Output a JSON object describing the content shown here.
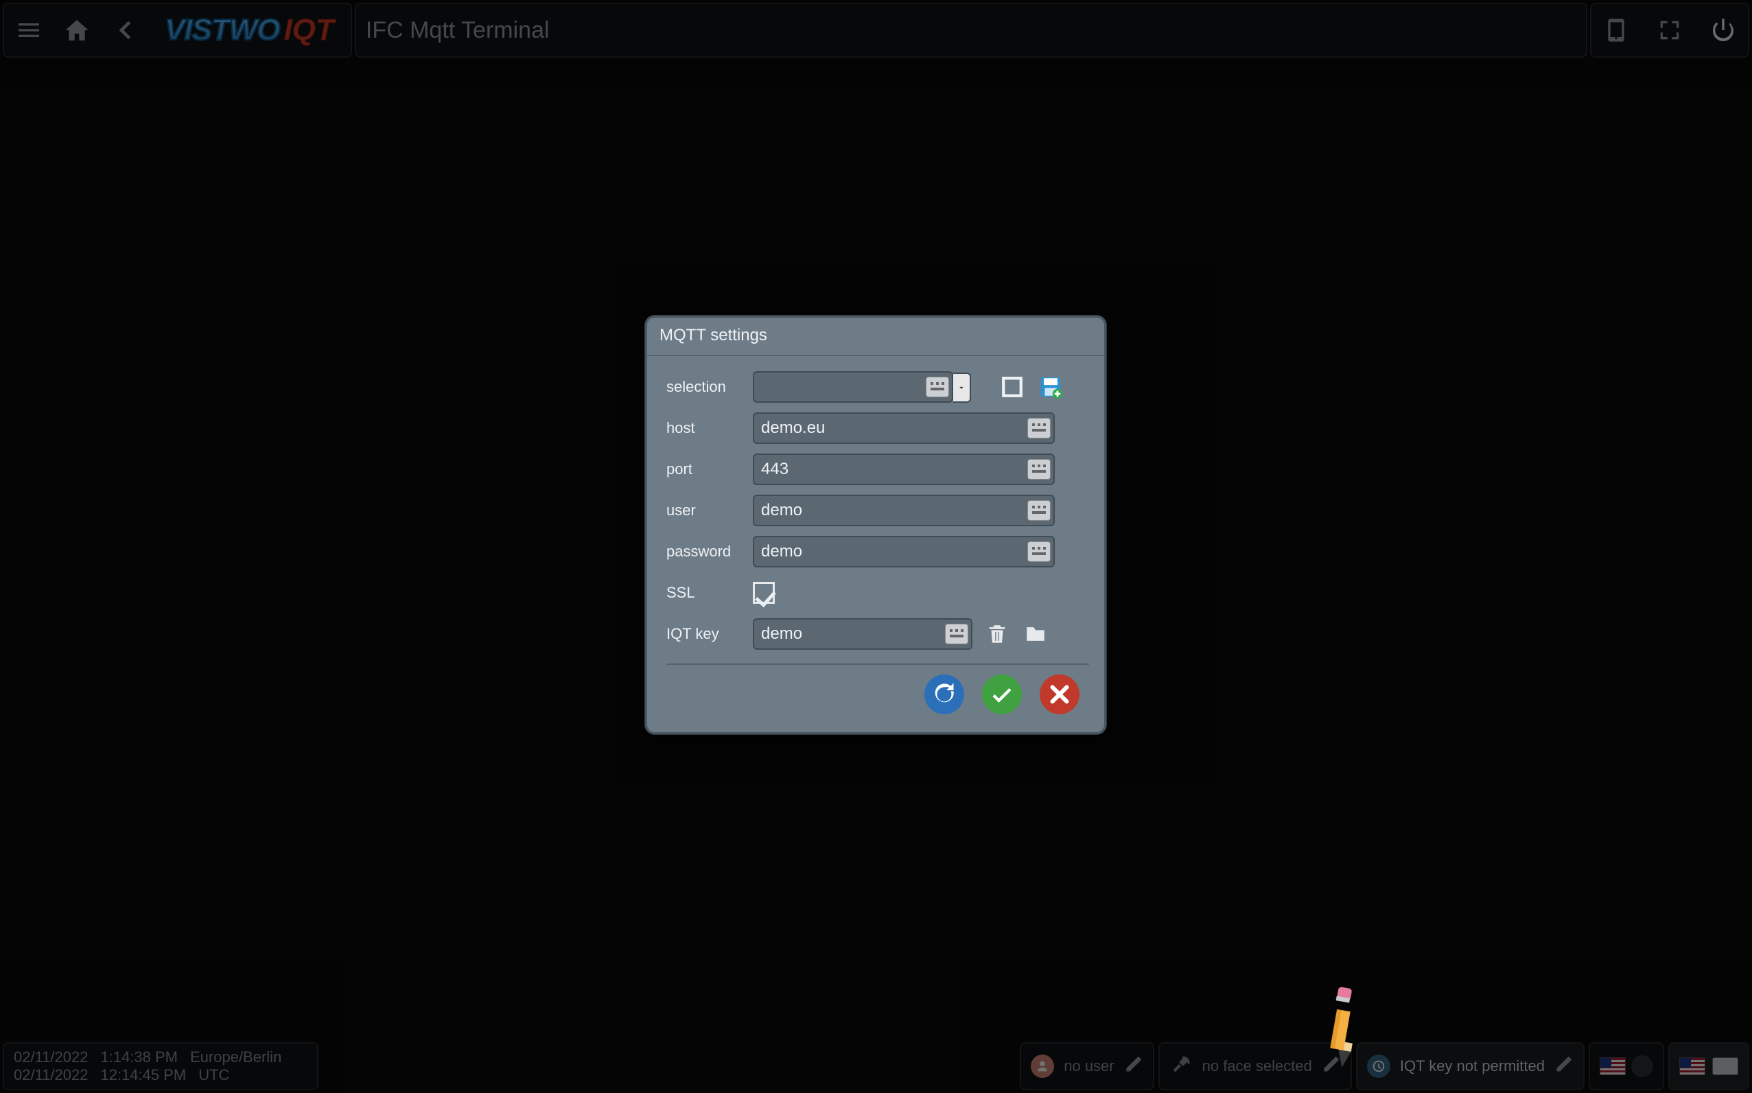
{
  "topbar": {
    "title": "IFC Mqtt Terminal",
    "logo": {
      "text1": "VISTWO",
      "text2": "IQT"
    }
  },
  "dialog": {
    "title": "MQTT settings",
    "labels": {
      "selection": "selection",
      "host": "host",
      "port": "port",
      "user": "user",
      "password": "password",
      "ssl": "SSL",
      "iqt_key": "IQT key"
    },
    "values": {
      "selection": "",
      "host": "demo.eu",
      "port": "443",
      "user": "demo",
      "password": "demo",
      "ssl_checked": true,
      "iqt_key": "demo"
    }
  },
  "bottombar": {
    "clock": {
      "line1_date": "02/11/2022",
      "line1_time": "1:14:38 PM",
      "line1_tz": "Europe/Berlin",
      "line2_date": "02/11/2022",
      "line2_time": "12:14:45 PM",
      "line2_tz": "UTC"
    },
    "user_text": "no user",
    "face_text": "no face selected",
    "status_text": "IQT key not permitted"
  },
  "icons": {
    "menu": "menu-icon",
    "home": "home-icon",
    "back": "chevron-left-icon",
    "mobile": "mobile-icon",
    "fullscreen": "fullscreen-icon",
    "power": "power-icon",
    "new_window": "new-window-icon",
    "save_disk": "floppy-save-icon",
    "trash": "trash-icon",
    "folder": "folder-icon",
    "reload": "reload-icon",
    "ok": "check-icon",
    "cancel": "close-icon",
    "edit": "edit-icon",
    "pencil": "pencil-icon"
  }
}
